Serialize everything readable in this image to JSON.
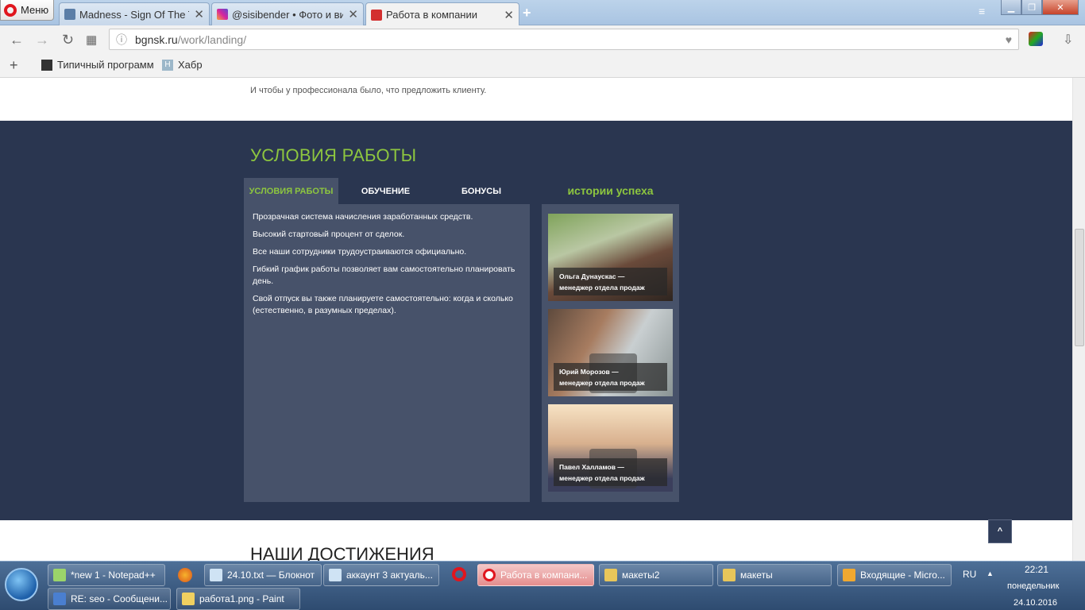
{
  "browser": {
    "menu_label": "Меню",
    "tabs": [
      {
        "title": "Madness - Sign Of The Tim"
      },
      {
        "title": "@sisibender • Фото и вид"
      },
      {
        "title": "Работа в компании"
      }
    ],
    "url_host": "bgnsk.ru",
    "url_path": "/work/landing/",
    "bookmarks": [
      {
        "label": "Типичный программ"
      },
      {
        "label": "Хабр",
        "icon_letter": "H"
      }
    ]
  },
  "page": {
    "intro_text": "И чтобы у профессионала было, что предложить клиенту.",
    "section_title": "УСЛОВИЯ РАБОТЫ",
    "tabs": [
      {
        "label": "УСЛОВИЯ РАБОТЫ"
      },
      {
        "label": "ОБУЧЕНИЕ"
      },
      {
        "label": "БОНУСЫ"
      }
    ],
    "conditions": [
      "Прозрачная система начисления заработанных средств.",
      "Высокий стартовый процент от сделок.",
      "Все наши сотрудники трудоустраиваются официально.",
      "Гибкий график работы позволяет вам самостоятельно планировать день.",
      "Свой отпуск вы также планируете самостоятельно: когда и сколько (естественно, в разумных пределах)."
    ],
    "stories_title": "истории успеха",
    "stories": [
      {
        "name": "Ольга Дунаускас —",
        "role": "менеджер отдела продаж"
      },
      {
        "name": "Юрий Морозов —",
        "role": "менеджер отдела продаж"
      },
      {
        "name": "Павел Халламов —",
        "role": "менеджер отдела продаж"
      }
    ],
    "to_top_label": "^",
    "achievements_title": "НАШИ ДОСТИЖЕНИЯ"
  },
  "taskbar": {
    "row1": [
      {
        "label": "*new 1 - Notepad++"
      },
      {
        "label": "24.10.txt — Блокнот"
      },
      {
        "label": "аккаунт 3 актуаль..."
      },
      {
        "label": "Работа в компани..."
      },
      {
        "label": "макеты2"
      },
      {
        "label": "макеты"
      },
      {
        "label": "Входящие - Micro..."
      }
    ],
    "row2": [
      {
        "label": "RE: seo - Сообщени..."
      },
      {
        "label": "работа1.png - Paint"
      }
    ],
    "lang": "RU",
    "time": "22:21",
    "weekday": "понедельник",
    "date": "24.10.2016"
  },
  "colors": {
    "accent_green": "#8dc63f",
    "dark_bg": "#2a3650",
    "panel_bg": "#47526a"
  }
}
